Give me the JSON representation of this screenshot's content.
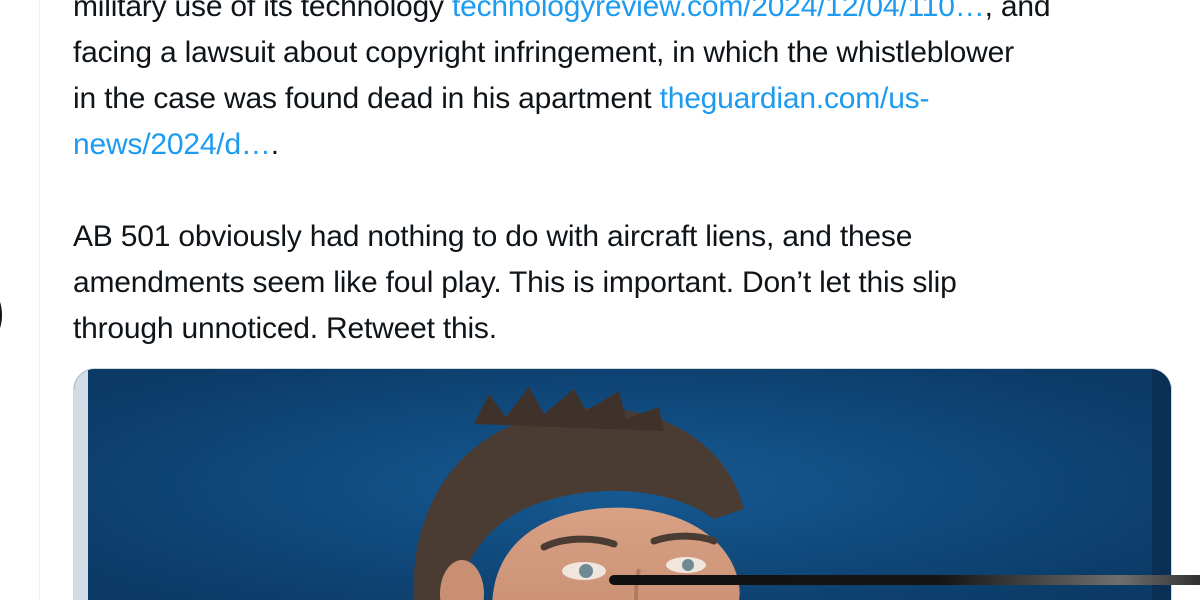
{
  "tweet": {
    "paragraph1": {
      "line0_prefix": "military use of its technology ",
      "line0_link": "technologyreview.com/2024/12/04/110…",
      "line0_suffix": ", and",
      "line1": "facing a lawsuit about copyright infringement, in which the whistleblower",
      "line2_prefix": "in the case was found dead in his apartment ",
      "line2_link": "theguardian.com/us-",
      "line3_link": "news/2024/d…",
      "line3_suffix": "."
    },
    "paragraph2": {
      "line1": "AB 501 obviously had nothing to do with aircraft liens, and these",
      "line2": "amendments seem like foul play. This is important. Don’t let this slip",
      "line3": "through unnoticed. Retweet this."
    }
  },
  "colors": {
    "text": "#0f1419",
    "link": "#1d9bf0",
    "media_background": "#0b4478"
  },
  "icons": {
    "left_ring": "avatar-ring"
  }
}
